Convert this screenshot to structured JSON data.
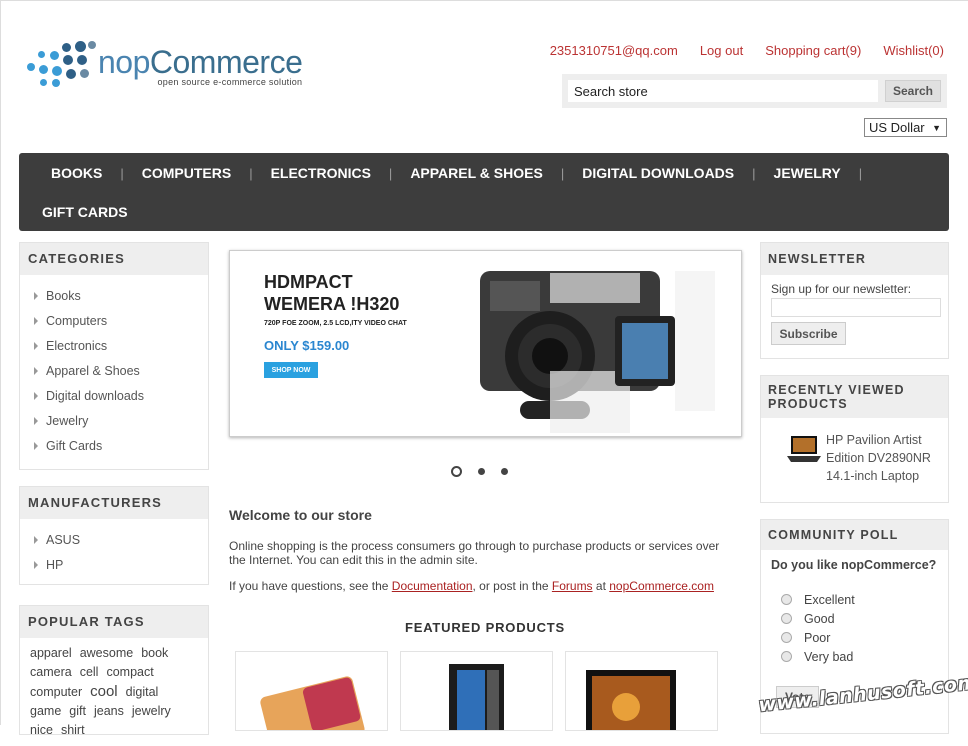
{
  "logo": {
    "text_part1": "nop",
    "text_part2": "Commerce",
    "tagline": "open source e-commerce solution"
  },
  "header": {
    "email": "2351310751@qq.com",
    "logout": "Log out",
    "cart": "Shopping cart(9)",
    "wishlist": "Wishlist(0)"
  },
  "search": {
    "value": "Search store",
    "button": "Search"
  },
  "currency": {
    "selected": "US Dollar"
  },
  "nav": {
    "row1": [
      "BOOKS",
      "COMPUTERS",
      "ELECTRONICS",
      "APPAREL & SHOES",
      "DIGITAL DOWNLOADS",
      "JEWELRY"
    ],
    "row2": [
      "GIFT CARDS"
    ]
  },
  "categories": {
    "title": "CATEGORIES",
    "items": [
      "Books",
      "Computers",
      "Electronics",
      "Apparel & Shoes",
      "Digital downloads",
      "Jewelry",
      "Gift Cards"
    ]
  },
  "manufacturers": {
    "title": "MANUFACTURERS",
    "items": [
      "ASUS",
      "HP"
    ]
  },
  "popular_tags": {
    "title": "POPULAR TAGS",
    "tags": [
      "apparel",
      "awesome",
      "book",
      "camera",
      "cell",
      "compact",
      "computer",
      "cool",
      "digital",
      "game",
      "gift",
      "jeans",
      "jewelry",
      "nice",
      "shirt"
    ]
  },
  "slider": {
    "line1": "HDMPACT",
    "line2": "WEMERA !H320",
    "subline": "720P FOE ZOOM, 2.5 LCD,ITY VIDEO CHAT",
    "price": "ONLY $159.00",
    "button": "SHOP NOW"
  },
  "welcome": {
    "title": "Welcome to our store",
    "text": "Online shopping is the process consumers go through to purchase products or services over the Internet. You can edit this in the admin site.",
    "q_prefix": "If you have questions, see the ",
    "doc_link": "Documentation",
    "q_mid": ", or post in the ",
    "forums_link": "Forums",
    "q_at": " at ",
    "site_link": "nopCommerce.com"
  },
  "featured": {
    "title": "FEATURED PRODUCTS"
  },
  "newsletter": {
    "title": "NEWSLETTER",
    "label": "Sign up for our newsletter:",
    "button": "Subscribe"
  },
  "recently_viewed": {
    "title": "RECENTLY VIEWED PRODUCTS",
    "product": "HP Pavilion Artist Edition DV2890NR 14.1-inch Laptop"
  },
  "poll": {
    "title": "COMMUNITY POLL",
    "question": "Do you like nopCommerce?",
    "options": [
      "Excellent",
      "Good",
      "Poor",
      "Very bad"
    ],
    "button": "Vote"
  },
  "watermark": "www.lanhusoft.com"
}
